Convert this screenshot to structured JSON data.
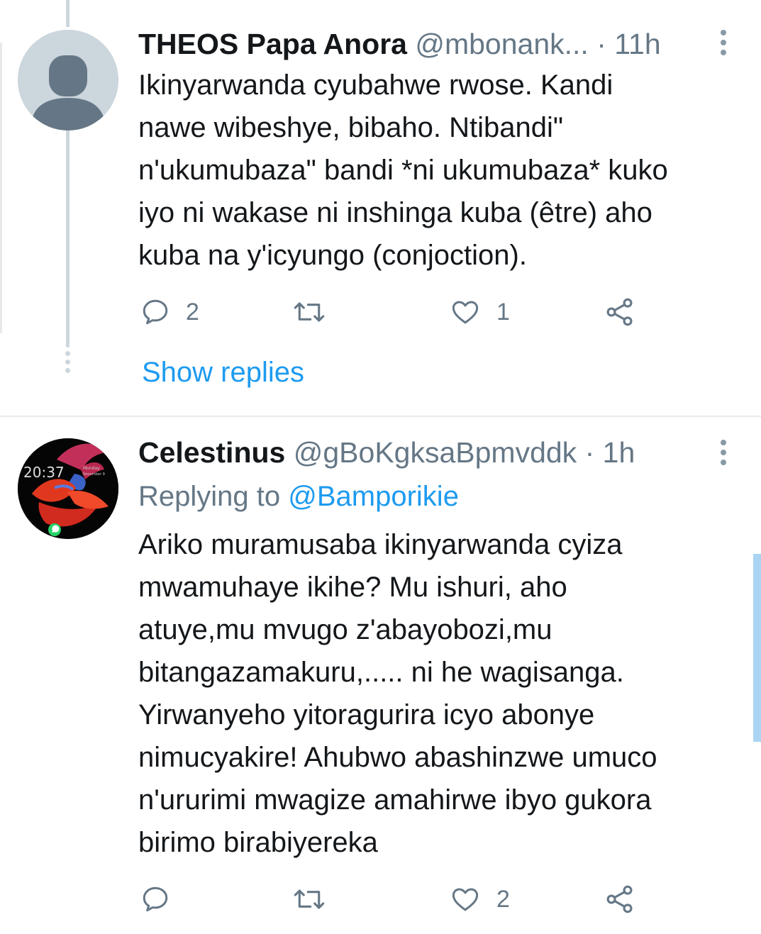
{
  "tweets": [
    {
      "name": "THEOS Papa Anora",
      "handle": "@mbonank...",
      "dot": "·",
      "time": "11h",
      "replying_prefix": "",
      "replying_to": "",
      "text": "Ikinyarwanda cyubahwe rwose. Kandi\nnawe wibeshye, bibaho. Ntibandi\"\nn'ukumubaza\" bandi *ni ukumubaza* kuko\niyo ni wakase ni inshinga kuba (être) aho\nkuba na y'icyungo (conjoction).",
      "reply_count": "2",
      "retweet_count": "",
      "like_count": "1",
      "avatar": "default-avatar-icon"
    },
    {
      "name": "Celestinus",
      "handle": "@gBoKgksaBpmvddk",
      "dot": "·",
      "time": "1h",
      "replying_prefix": "Replying to",
      "replying_to": "@Bamporikie",
      "text": "Ariko muramusaba ikinyarwanda cyiza\nmwamuhaye ikihe? Mu ishuri, aho\natuye,mu mvugo z'abayobozi,mu\nbitangazamakuru,..... ni he wagisanga.\nYirwanyeho yitoragurira icyo abonye\nnimucyakire! Ahubwo abashinzwe umuco\nn'ururimi mwagize amahirwe ibyo gukora\nbirimo birabiyereka",
      "reply_count": "",
      "retweet_count": "",
      "like_count": "2",
      "avatar": "betta-fish-avatar",
      "avatar_clock": "20:37",
      "avatar_date_day": "Monday",
      "avatar_date": "November 9"
    }
  ],
  "show_replies": "Show replies",
  "colors": {
    "accent": "#1d9bf0",
    "secondary_text": "#657786",
    "thread_line": "#ccd6dd",
    "divider": "#e6ecf0"
  }
}
